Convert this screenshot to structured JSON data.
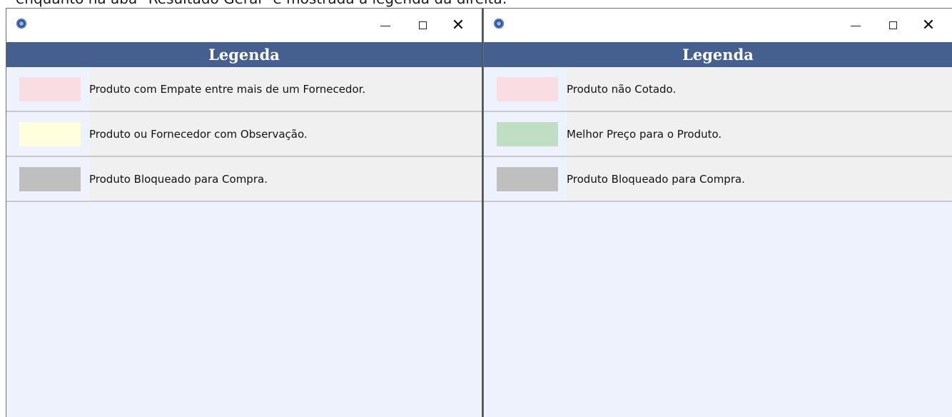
{
  "caption": "enquanto na aba \"Resultado Geral\" é mostrada a legenda da direita:",
  "colors": {
    "header_bg": "#45608e",
    "window_bg": "#eef2fc",
    "row_bg": "#f0f0f0"
  },
  "left_window": {
    "icon": "app-icon",
    "controls": {
      "minimize": "minimize-icon",
      "maximize": "maximize-icon",
      "close": "close-icon"
    },
    "header": "Legenda",
    "items": [
      {
        "label": "Produto com Empate entre mais de um Fornecedor.",
        "color": "#f8dde3"
      },
      {
        "label": "Produto ou Fornecedor com Observação.",
        "color": "#ffffde"
      },
      {
        "label": "Produto Bloqueado para Compra.",
        "color": "#bfbfbf"
      }
    ]
  },
  "right_window": {
    "icon": "app-icon",
    "controls": {
      "minimize": "minimize-icon",
      "maximize": "maximize-icon",
      "close": "close-icon"
    },
    "header": "Legenda",
    "items": [
      {
        "label": "Produto não Cotado.",
        "color": "#f8dde3"
      },
      {
        "label": "Melhor Preço para o Produto.",
        "color": "#c0dec3"
      },
      {
        "label": "Produto Bloqueado para Compra.",
        "color": "#bfbfbf"
      }
    ]
  }
}
